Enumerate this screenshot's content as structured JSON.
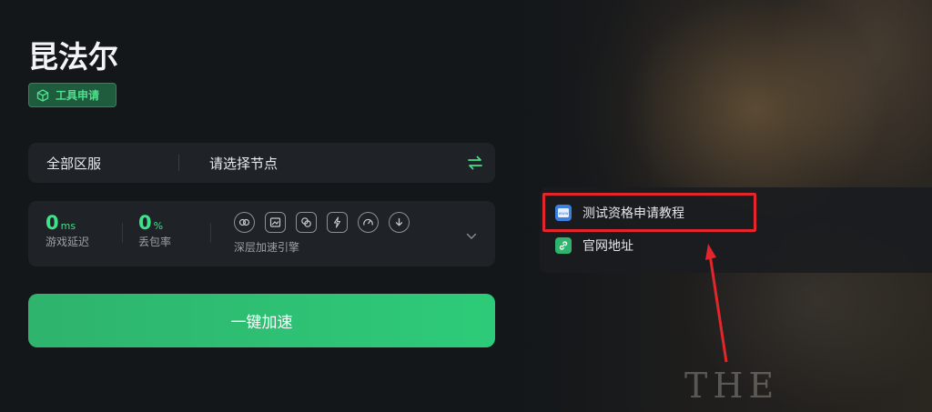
{
  "game": {
    "title": "昆法尔"
  },
  "tool_badge": {
    "label": "工具申请",
    "icon": "cube-icon"
  },
  "region": {
    "all_label": "全部区服",
    "node_placeholder": "请选择节点"
  },
  "stats": {
    "latency": {
      "value": "0",
      "unit": "ms",
      "label": "游戏延迟"
    },
    "packet_loss": {
      "value": "0",
      "unit": "%",
      "label": "丢包率"
    }
  },
  "engine": {
    "label": "深层加速引擎",
    "icons": [
      "link-icon",
      "image-icon",
      "overlap-icon",
      "lightning-icon",
      "gauge-icon",
      "download-icon"
    ]
  },
  "boost_button": {
    "label": "一键加速"
  },
  "side_panel": {
    "items": [
      {
        "label": "测试资格申请教程",
        "icon": "www-icon"
      },
      {
        "label": "官网地址",
        "icon": "link-icon"
      }
    ]
  },
  "watermark": {
    "text": "THE"
  },
  "colors": {
    "accent": "#2fc274",
    "highlight": "#e3262b",
    "background": "#15181b"
  }
}
